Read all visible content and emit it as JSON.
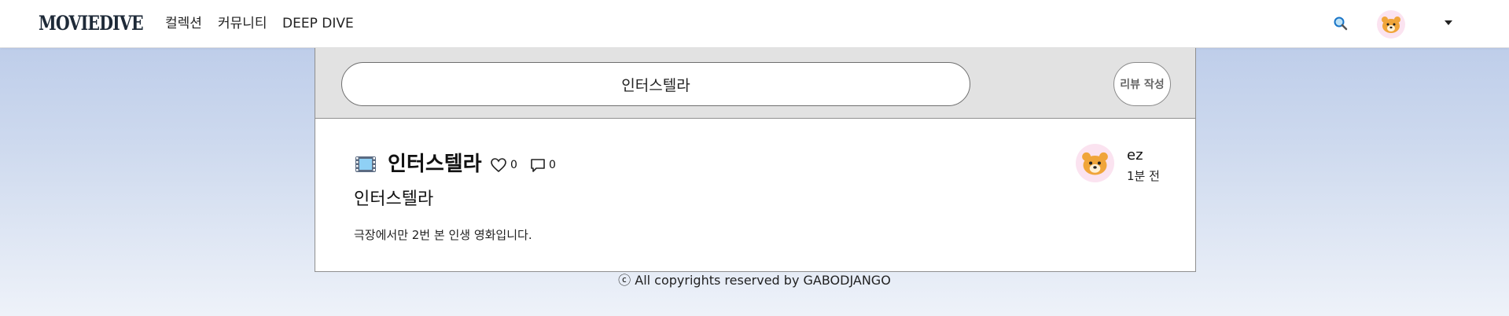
{
  "nav": {
    "logo": "MOVIEDIVE",
    "links": [
      "컬렉션",
      "커뮤니티",
      "DEEP DIVE"
    ],
    "icons": {
      "search": "search-icon",
      "avatar": "bear-avatar",
      "dropdown": "caret-down-icon"
    }
  },
  "search": {
    "query": "인터스텔라"
  },
  "review_button": {
    "label": "리뷰 작성"
  },
  "review": {
    "movie_icon": "film-frames-icon",
    "movie_title": "인터스텔라",
    "likes": "0",
    "comments": "0",
    "title": "인터스텔라",
    "body": "극장에서만 2번 본 인생 영화입니다.",
    "author": "ez",
    "time": "1분 전"
  },
  "footer": {
    "text": "ⓒ All copyrights reserved by GABODJANGO"
  },
  "colors": {
    "background_top": "#b7c8e8",
    "background_bottom": "#eef2f9",
    "search_area": "#e2e2e2",
    "avatar_bg": "#fbe3f0",
    "bear": "#f0a53a"
  }
}
